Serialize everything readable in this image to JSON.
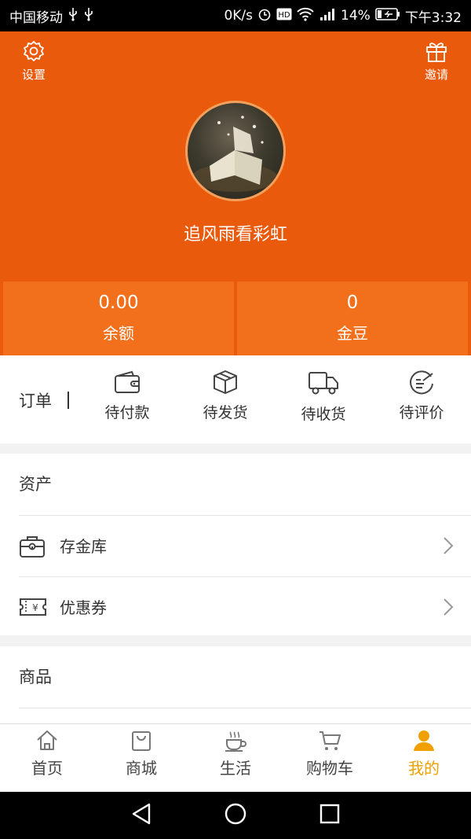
{
  "status": {
    "carrier": "中国移动",
    "speed": "0K/s",
    "battery": "14%",
    "time": "下午3:32"
  },
  "header": {
    "settings_label": "设置",
    "invite_label": "邀请",
    "username": "追风雨看彩虹",
    "bg_color": "#ea5a0c"
  },
  "stats": [
    {
      "value": "0.00",
      "label": "余额"
    },
    {
      "value": "0",
      "label": "金豆"
    }
  ],
  "orders": {
    "title": "订单",
    "items": [
      {
        "label": "待付款",
        "icon": "wallet-icon"
      },
      {
        "label": "待发货",
        "icon": "box-icon"
      },
      {
        "label": "待收货",
        "icon": "truck-icon"
      },
      {
        "label": "待评价",
        "icon": "review-icon"
      }
    ]
  },
  "assets": {
    "title": "资产",
    "rows": [
      {
        "label": "存金库",
        "icon": "vault-icon"
      },
      {
        "label": "优惠券",
        "icon": "coupon-icon"
      }
    ]
  },
  "goods": {
    "title": "商品"
  },
  "tabs": [
    {
      "label": "首页",
      "icon": "home-icon"
    },
    {
      "label": "商城",
      "icon": "bag-icon"
    },
    {
      "label": "生活",
      "icon": "coffee-icon"
    },
    {
      "label": "购物车",
      "icon": "cart-icon"
    },
    {
      "label": "我的",
      "icon": "user-icon",
      "active": true
    }
  ],
  "accent_color": "#f0a000"
}
